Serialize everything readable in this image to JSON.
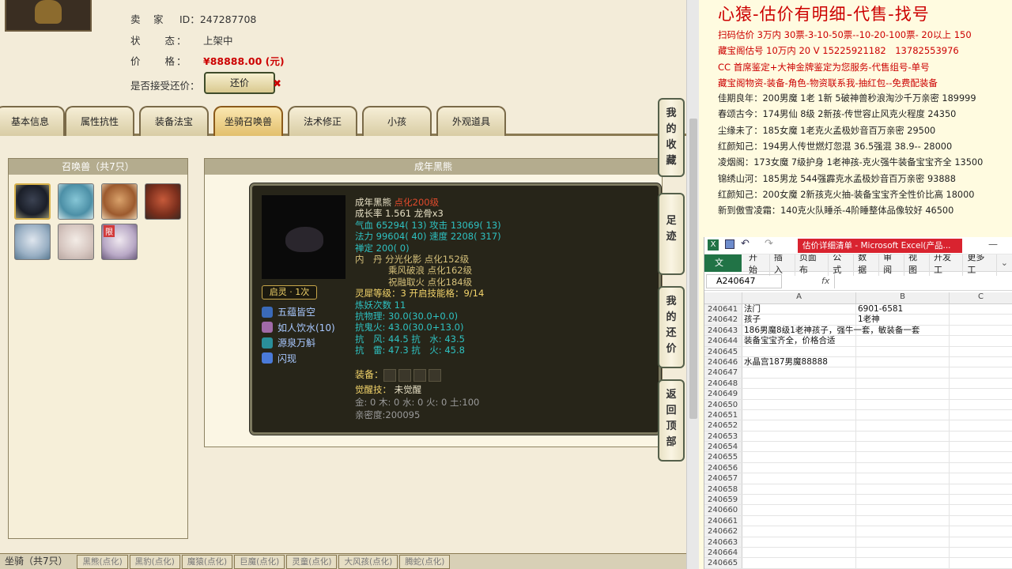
{
  "seller": {
    "seller_label": "卖　家",
    "id_label": "ID：",
    "id_value": "247287708",
    "status_label": "状　　态：",
    "status_value": "上架中",
    "price_label": "价　　格：",
    "price_value": "¥88888.00 (元)",
    "haggle_label": "是否接受还价：",
    "haggle_button": "还价"
  },
  "tabs": [
    "基本信息",
    "属性抗性",
    "装备法宝",
    "坐骑召唤兽",
    "法术修正",
    "小孩",
    "外观道具"
  ],
  "pets_panel": {
    "title": "召唤兽（共7只）",
    "limit_badge": "限"
  },
  "detail_panel": {
    "title": "成年黑熊"
  },
  "pet": {
    "name": "成年黑熊",
    "level": "点化200级",
    "growth": "成长率 1.561 龙骨x3",
    "hp": "气血 65294( 13)",
    "atk": "攻击 13069( 13)",
    "mp": "法力 99604( 40)",
    "spd": "速度 2208( 317)",
    "zen": "禅定 200( 0)",
    "dan_label": "内　丹",
    "dan": [
      "分光化影 点化152级",
      "乘风破浪 点化162级",
      "祝融取火 点化184级"
    ],
    "lingxi": "灵犀等级：3 开启技能格：9/14",
    "lianyao": "炼妖次数 11",
    "res": [
      "抗物理: 30.0(30.0+0.0)",
      "抗鬼火: 43.0(30.0+13.0)",
      "抗　风: 44.5 抗　水: 43.5",
      "抗　雷: 47.3 抗　火: 45.8"
    ],
    "equip_label": "装备：",
    "juexing_label": "觉醒技：",
    "juexing_value": "未觉醒",
    "elements": "金: 0 木: 0 水: 0 火: 0 土:100",
    "intimacy": "亲密度:200095",
    "qiling": "启灵 · 1次",
    "skills": [
      "五蕴皆空",
      "如人饮水(10)",
      "源泉万斛",
      "闪现"
    ]
  },
  "side_buttons": [
    "我的收藏",
    "足迹",
    "我的还价",
    "返回顶部"
  ],
  "bottom_bar": {
    "label": "坐骑（共7只）",
    "items": [
      "黑熊(点化)",
      "黑豹(点化)",
      "魔猿(点化)",
      "巨魔(点化)",
      "灵童(点化)",
      "大风孩(点化)",
      "腾蛇(点化)"
    ]
  },
  "ads": {
    "title": "心猿-估价有明细-代售-找号",
    "lines": [
      "扫码估价 3万内 30票-3-10-50票--10-20-100票- 20以上 150",
      "藏宝阁估号 10万内 20 V 15225921182　13782553976",
      "CC 首席鉴定+大神金牌鉴定为您服务-代售组号-单号",
      "藏宝阁物资-装备-角色-物资联系我-抽红包--免费配装备"
    ],
    "listings": [
      "佳期良年：200男魔 1老 1新 5破神兽秒浪淘沙千万亲密 189999",
      "春颂古今：174男仙 8级 2新孩-传世容止风克火程度 24350",
      "尘缘未了：185女魔 1老克火孟极妙音百万亲密 29500",
      "红颜知己：194男人传世燃灯忽混 36.5强混 38.9-- 28000",
      "凌烟阁：173女魔 7级护身 1老神孩-克火强牛装备宝宝齐全 13500",
      "锦绣山河：185男龙 544强霹克水孟极妙音百万亲密 93888",
      "红颜知己：200女魔 2新孩克火抽-装备宝宝齐全性价比高 18000",
      "新到傲雪凌霜：140克火队睡杀-4阶睡整体品像较好 46500"
    ]
  },
  "excel": {
    "title": "估价详细清单 - Microsoft Excel(产品...",
    "ribbon": [
      "文件",
      "开始",
      "插入",
      "页面布",
      "公式",
      "数据",
      "审阅",
      "视图",
      "开发工",
      "更多工"
    ],
    "name_box": "A240647",
    "fx": "fx",
    "col_headers": [
      "A",
      "B",
      "C"
    ],
    "rows": [
      {
        "n": "240641",
        "a": "法门",
        "b": "6901-6581"
      },
      {
        "n": "240642",
        "a": "孩子",
        "b": "1老神"
      },
      {
        "n": "240643",
        "a": "186男魔8级1老神孩子，强牛一套，敏装备一套",
        "b": ""
      },
      {
        "n": "240644",
        "a": "装备宝宝齐全，价格合适",
        "b": ""
      },
      {
        "n": "240645",
        "a": "",
        "b": ""
      },
      {
        "n": "240646",
        "a": "水晶宫187男魔88888",
        "b": ""
      },
      {
        "n": "240647",
        "a": "",
        "b": ""
      },
      {
        "n": "240648",
        "a": "",
        "b": ""
      },
      {
        "n": "240649",
        "a": "",
        "b": ""
      },
      {
        "n": "240650",
        "a": "",
        "b": ""
      },
      {
        "n": "240651",
        "a": "",
        "b": ""
      },
      {
        "n": "240652",
        "a": "",
        "b": ""
      },
      {
        "n": "240653",
        "a": "",
        "b": ""
      },
      {
        "n": "240654",
        "a": "",
        "b": ""
      },
      {
        "n": "240655",
        "a": "",
        "b": ""
      },
      {
        "n": "240656",
        "a": "",
        "b": ""
      },
      {
        "n": "240657",
        "a": "",
        "b": ""
      },
      {
        "n": "240658",
        "a": "",
        "b": ""
      },
      {
        "n": "240659",
        "a": "",
        "b": ""
      },
      {
        "n": "240660",
        "a": "",
        "b": ""
      },
      {
        "n": "240661",
        "a": "",
        "b": ""
      },
      {
        "n": "240662",
        "a": "",
        "b": ""
      },
      {
        "n": "240663",
        "a": "",
        "b": ""
      },
      {
        "n": "240664",
        "a": "",
        "b": ""
      },
      {
        "n": "240665",
        "a": "",
        "b": ""
      }
    ]
  }
}
